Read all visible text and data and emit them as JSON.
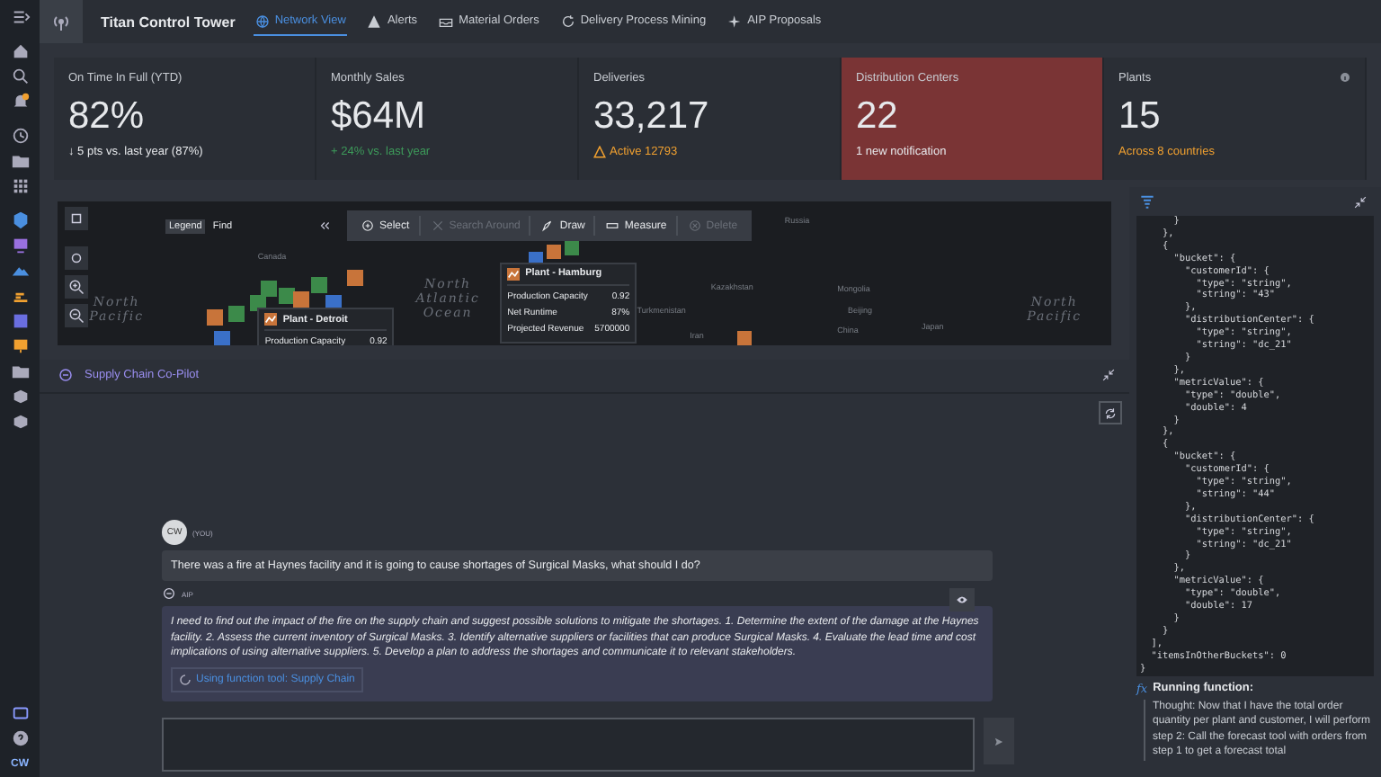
{
  "app": {
    "title": "Titan Control Tower"
  },
  "tabs": [
    {
      "label": "Network View",
      "selected": true
    },
    {
      "label": "Alerts",
      "selected": false
    },
    {
      "label": "Material Orders",
      "selected": false
    },
    {
      "label": "Delivery Process Mining",
      "selected": false
    },
    {
      "label": "AIP Proposals",
      "selected": false
    }
  ],
  "kpis": [
    {
      "title": "On Time In Full (YTD)",
      "value": "82%",
      "note": "↓ 5 pts vs. last year (87%)",
      "kind": "neutral",
      "highlighted": false
    },
    {
      "title": "Monthly Sales",
      "value": "$64M",
      "note": "+ 24% vs. last year",
      "kind": "positive",
      "highlighted": false
    },
    {
      "title": "Deliveries",
      "value": "33,217",
      "note": "Active 12793",
      "kind": "warning",
      "highlighted": false
    },
    {
      "title": "Distribution Centers",
      "value": "22",
      "note": "1 new notification",
      "kind": "neutral",
      "highlighted": true
    },
    {
      "title": "Plants",
      "value": "15",
      "note": "Across 8 countries",
      "kind": "caution",
      "highlighted": false
    }
  ],
  "map": {
    "legend_tabs": [
      {
        "label": "Legend",
        "selected": true
      },
      {
        "label": "Find",
        "selected": false
      }
    ],
    "tools": [
      {
        "label": "Select",
        "disabled": false
      },
      {
        "label": "Search Around",
        "disabled": true
      },
      {
        "label": "Draw",
        "disabled": false
      },
      {
        "label": "Measure",
        "disabled": false
      },
      {
        "label": "Delete",
        "disabled": true
      }
    ],
    "labels": [
      {
        "text": "North\nPacific",
        "kind": "ocean"
      },
      {
        "text": "North\nAtlantic\nOcean",
        "kind": "ocean"
      },
      {
        "text": "North\nPacific",
        "kind": "ocean"
      },
      {
        "text": "Canada",
        "kind": "place"
      },
      {
        "text": "Russia",
        "kind": "place"
      },
      {
        "text": "Kazakhstan",
        "kind": "place"
      },
      {
        "text": "Mongolia",
        "kind": "place"
      },
      {
        "text": "Turkmenistan",
        "kind": "place"
      },
      {
        "text": "Beijing",
        "kind": "place"
      },
      {
        "text": "China",
        "kind": "place"
      },
      {
        "text": "Japan",
        "kind": "place"
      },
      {
        "text": "Iran",
        "kind": "place"
      }
    ],
    "popups": [
      {
        "title": "Plant - Detroit",
        "rows": [
          {
            "label": "Production Capacity",
            "value": "0.92"
          }
        ]
      },
      {
        "title": "Plant - Hamburg",
        "rows": [
          {
            "label": "Production Capacity",
            "value": "0.92"
          },
          {
            "label": "Net Runtime",
            "value": "87%"
          },
          {
            "label": "Projected Revenue",
            "value": "5700000"
          }
        ]
      }
    ]
  },
  "copilot": {
    "title": "Supply Chain Co-Pilot",
    "messages": [
      {
        "kind": "user",
        "avatar": "CW",
        "author": "(YOU)",
        "text": "There was a fire at Haynes facility and it is going to cause shortages of Surgical Masks, what should I do?"
      },
      {
        "kind": "ai",
        "author": "AIP",
        "text": "I need to find out the impact of the fire on the supply chain and suggest possible solutions to mitigate the shortages. 1. Determine the extent of the damage at the Haynes facility. 2. Assess the current inventory of Surgical Masks. 3. Identify alternative suppliers or facilities that can produce Surgical Masks. 4. Evaluate the lead time and cost implications of using alternative suppliers. 5. Develop a plan to address the shortages and communicate it to relevant stakeholders.",
        "tool": "Using function tool: Supply Chain"
      }
    ]
  },
  "code_panel": {
    "lines": [
      "      }",
      "    },",
      "    {",
      "      \"bucket\": {",
      "        \"customerId\": {",
      "          \"type\": \"string\",",
      "          \"string\": \"43\"",
      "        },",
      "        \"distributionCenter\": {",
      "          \"type\": \"string\",",
      "          \"string\": \"dc_21\"",
      "        }",
      "      },",
      "      \"metricValue\": {",
      "        \"type\": \"double\",",
      "        \"double\": 4",
      "      }",
      "    },",
      "    {",
      "      \"bucket\": {",
      "        \"customerId\": {",
      "          \"type\": \"string\",",
      "          \"string\": \"44\"",
      "        },",
      "        \"distributionCenter\": {",
      "          \"type\": \"string\",",
      "          \"string\": \"dc_21\"",
      "        }",
      "      },",
      "      \"metricValue\": {",
      "        \"type\": \"double\",",
      "        \"double\": 17",
      "      }",
      "    }",
      "  ],",
      "  \"itemsInOtherBuckets\": 0",
      "}"
    ],
    "function_icon": "fx",
    "function_label": "Running function:",
    "thought": "Thought: Now that I have the total order quantity per plant and customer, I will perform step 2: Call the forecast tool with orders from step 1 to get a forecast total"
  },
  "user": {
    "initials": "CW"
  }
}
